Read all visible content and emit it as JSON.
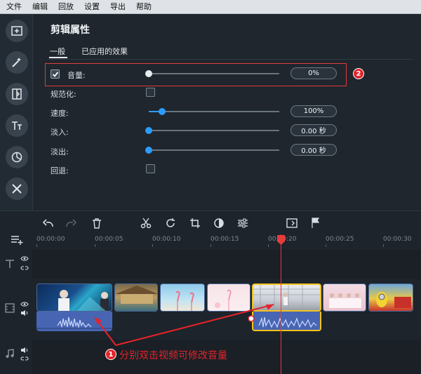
{
  "menu": [
    "文件",
    "编辑",
    "回放",
    "设置",
    "导出",
    "帮助"
  ],
  "tools": [
    {
      "icon": "add-media-icon"
    },
    {
      "icon": "magic-wand-icon"
    },
    {
      "icon": "transition-icon"
    },
    {
      "icon": "titles-icon"
    },
    {
      "icon": "stickers-icon"
    },
    {
      "icon": "more-tools-icon"
    }
  ],
  "panel": {
    "title": "剪辑属性",
    "tabs": [
      "一般",
      "已应用的效果"
    ],
    "volume": {
      "label": "音量:",
      "value": "0%",
      "level": 0,
      "checked": true
    },
    "normalize": {
      "label": "规范化:",
      "checked": false
    },
    "speed": {
      "label": "速度:",
      "value": "100%",
      "level": 0.1
    },
    "fade_in": {
      "label": "淡入:",
      "value": "0.00 秒",
      "level": 0
    },
    "fade_out": {
      "label": "淡出:",
      "value": "0.00 秒",
      "level": 0
    },
    "reverse": {
      "label": "回退:",
      "checked": false
    }
  },
  "annotations": {
    "badge1": "1",
    "badge2": "2",
    "note": "分别双击视频可修改音量"
  },
  "ruler": [
    "00:00:00",
    "00:00:05",
    "00:00:10",
    "00:00:15",
    "00:00:20",
    "00:00:25",
    "00:00:30"
  ],
  "colors": {
    "accent": "#2d9cff",
    "highlight": "#e23b3b",
    "selected_clip": "#f2c21b",
    "audio": "#4765b2"
  }
}
